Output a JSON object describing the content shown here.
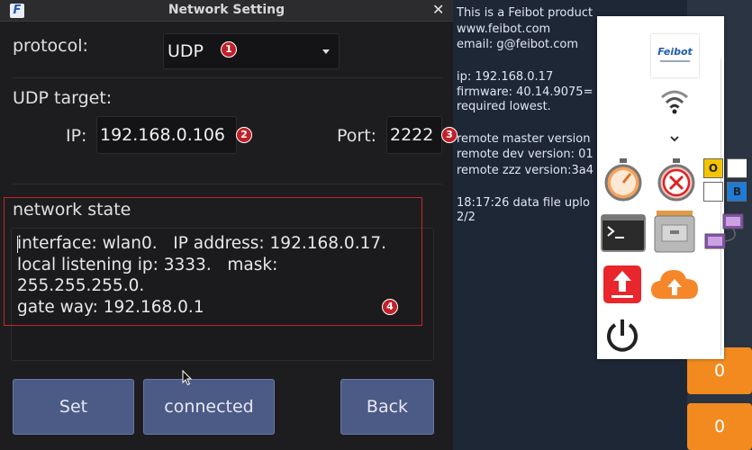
{
  "dialog": {
    "title": "Network Setting",
    "app_icon": "F",
    "close_label": "✕",
    "protocol_label": "protocol:",
    "protocol_value": "UDP",
    "target_label": "UDP target:",
    "ip_label": "IP:",
    "ip_value": "192.168.0.106",
    "port_label": "Port:",
    "port_value": "2222",
    "state_label": "network state",
    "state_text": "interface: wlan0.   IP address: 192.168.0.17.\nlocal listening ip: 3333.   mask:\n255.255.255.0.\ngate way: 192.168.0.1",
    "buttons": {
      "set": "Set",
      "connected": "connected",
      "back": "Back"
    },
    "badges": [
      "1",
      "2",
      "3",
      "4"
    ]
  },
  "info_panel": {
    "lines": [
      "This is a Feibot product",
      "www.feibot.com",
      "email: g@feibot.com",
      "ip: 192.168.0.17",
      "firmware: 40.14.9075=",
      "required lowest.",
      "remote master version",
      "remote dev version: 01",
      "remote zzz version:3a4",
      "18:17:26 data file uplo",
      "2/2"
    ]
  },
  "strip": {
    "value_1": "0",
    "value_2": "0"
  },
  "popup": {
    "logo_text": "Feibot",
    "toggle_o": "O",
    "toggle_b": "B"
  },
  "colors": {
    "badge": "#c0202a",
    "button": "#4c5a86",
    "orange": "#f28a1f",
    "panel_bg": "#1e2736"
  }
}
